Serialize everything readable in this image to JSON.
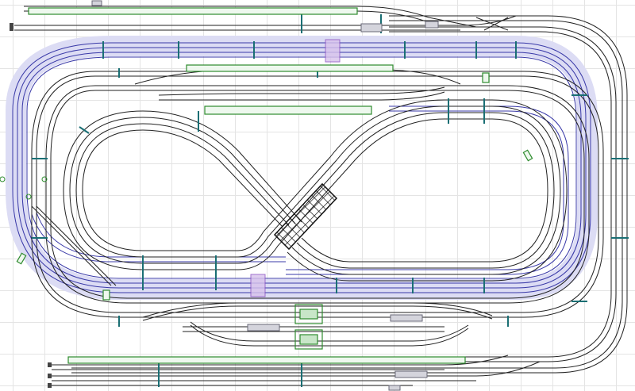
{
  "colors": {
    "grid": "#e4e4e4",
    "rail": "#222222",
    "upper_level_rail": "#3a3aa8",
    "upper_level_fill": "#dcdcf4",
    "tie": "#1a6f74",
    "platform": "#2e8b2e",
    "platform_fill": "#eef8ee",
    "bridge": "#111111",
    "tunnel_portal": "#b07ad0",
    "rolling_stock": "#6a6a78",
    "buffer_stop": "#444444"
  },
  "icons": {
    "buffer_stop": "buffer-stop-icon",
    "portal": "tunnel-portal-icon",
    "signal": "signal-marker-icon"
  },
  "layers": [
    "lower-level-tracks",
    "upper-level-tracks",
    "figure-eight-loop",
    "bridge",
    "platforms",
    "rolling-stock"
  ]
}
